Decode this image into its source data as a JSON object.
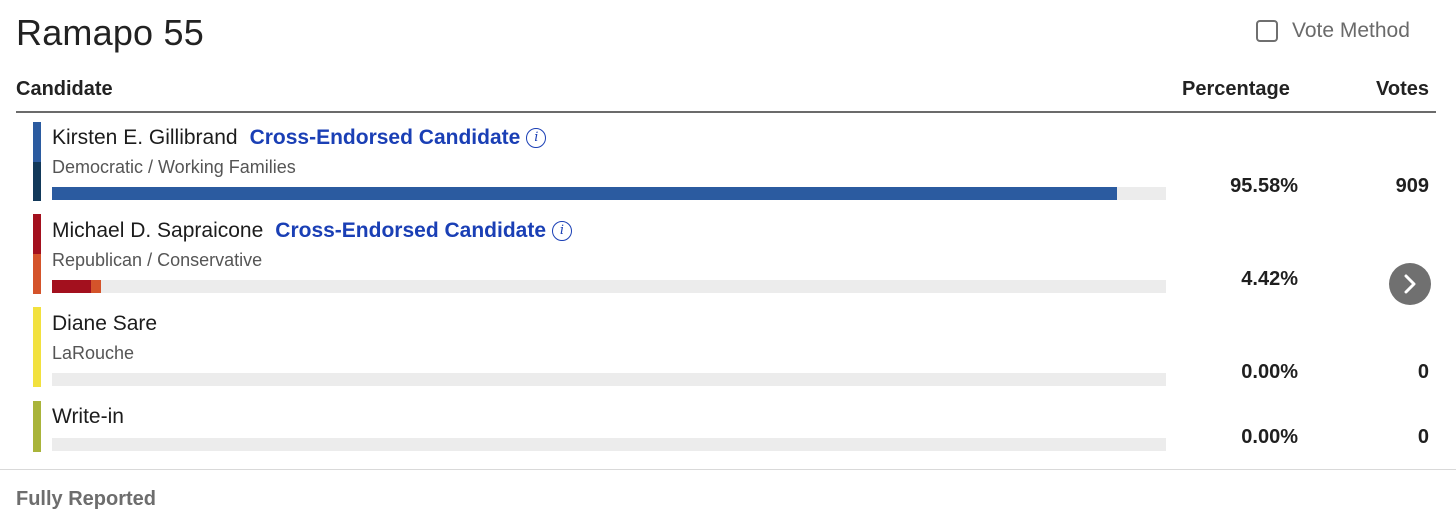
{
  "precinct_title": "Ramapo 55",
  "vote_method": {
    "label": "Vote Method",
    "checked": false
  },
  "table_header": {
    "candidate": "Candidate",
    "percentage": "Percentage",
    "votes": "Votes"
  },
  "candidates": [
    {
      "name": "Kirsten E. Gillibrand",
      "cross_label": "Cross-Endorsed Candidate",
      "party": "Democratic / Working Families",
      "percentage": "95.58%",
      "votes": "909",
      "share": 0.9558,
      "stripe_colors": [
        "#2b5ba0",
        "#12395a"
      ],
      "bar_segments": [
        {
          "share": 0.9558,
          "color": "#2b5ba0"
        }
      ]
    },
    {
      "name": "Michael D. Sapraicone",
      "cross_label": "Cross-Endorsed Candidate",
      "party": "Republican / Conservative",
      "percentage": "4.42%",
      "votes": "",
      "share": 0.0442,
      "stripe_colors": [
        "#a3101e",
        "#d4532a"
      ],
      "bar_segments": [
        {
          "share": 0.035,
          "color": "#a3101e"
        },
        {
          "share": 0.0092,
          "color": "#d4532a"
        }
      ]
    },
    {
      "name": "Diane Sare",
      "cross_label": "",
      "party": "LaRouche",
      "percentage": "0.00%",
      "votes": "0",
      "share": 0,
      "stripe_colors": [
        "#f2e13e"
      ],
      "bar_segments": []
    },
    {
      "name": "Write-in",
      "cross_label": "",
      "party": "",
      "percentage": "0.00%",
      "votes": "0",
      "share": 0,
      "stripe_colors": [
        "#a9b43a"
      ],
      "bar_segments": []
    }
  ],
  "footer_status": "Fully Reported",
  "icons": {
    "info": "info-icon",
    "next": "chevron-right-icon",
    "checkbox": "checkbox-icon"
  }
}
